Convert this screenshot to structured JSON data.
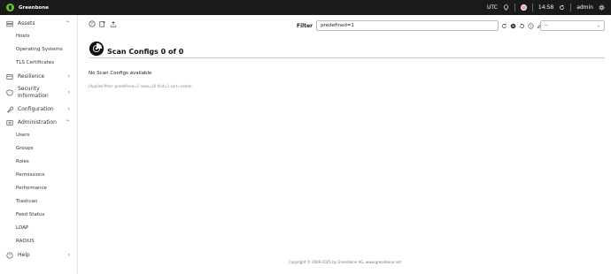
{
  "app": {
    "brand": "Greenbone"
  },
  "topbar": {
    "timezone": "UTC",
    "time": "14:58",
    "user": "admin"
  },
  "sidebar": {
    "groups": [
      {
        "label": "Assets",
        "icon": "assets-icon",
        "expanded": true,
        "items": [
          "Hosts",
          "Operating Systems",
          "TLS Certificates"
        ]
      },
      {
        "label": "Resilience",
        "icon": "resilience-icon",
        "expanded": false
      },
      {
        "label": "Security Information",
        "icon": "shield-icon",
        "expanded": false
      },
      {
        "label": "Configuration",
        "icon": "wrench-icon",
        "expanded": false
      },
      {
        "label": "Administration",
        "icon": "admin-icon",
        "expanded": true,
        "items": [
          "Users",
          "Groups",
          "Roles",
          "Permissions",
          "Performance",
          "Trashcan",
          "Feed Status",
          "LDAP",
          "RADIUS"
        ]
      },
      {
        "label": "Help",
        "icon": "help-icon",
        "expanded": false
      }
    ]
  },
  "filter": {
    "label": "Filter",
    "value": "predefined=1",
    "select_value": "--"
  },
  "page": {
    "title": "Scan Configs 0 of 0",
    "empty_message": "No Scan Configs available",
    "applied_filter": "(Applied filter: predefined=1 rows=10 first=1 sort=name)"
  },
  "footer": {
    "copyright": "Copyright © 2009-2025 by Greenbone AG, www.greenbone.net"
  },
  "colors": {
    "topbar": "#1a1a1a",
    "brand_green": "#66c430"
  }
}
